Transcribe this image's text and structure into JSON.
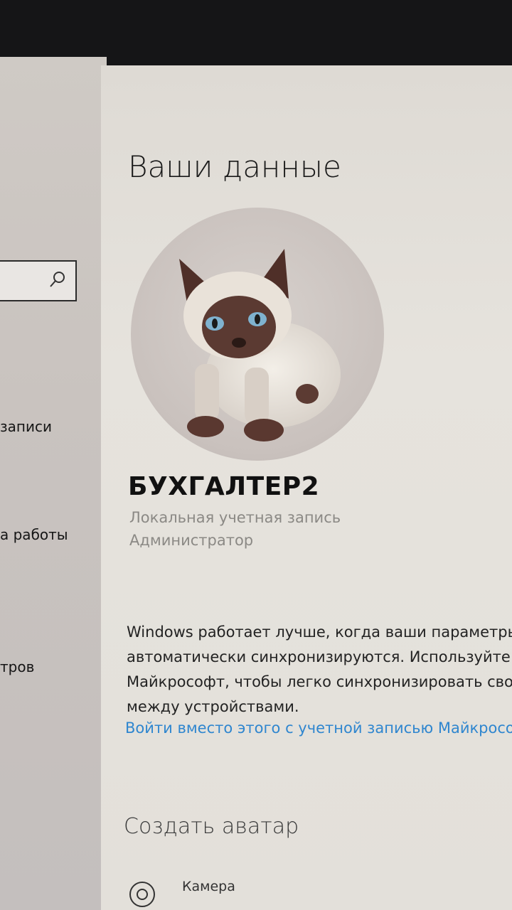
{
  "sidebar": {
    "search": {
      "placeholder": "",
      "icon": "search-icon"
    },
    "items": [
      {
        "label": "записи"
      },
      {
        "label": "а работы"
      },
      {
        "label": "тров"
      }
    ]
  },
  "main": {
    "title": "Ваши данные",
    "user": {
      "name": "БУХГАЛТЕР2",
      "account_type": "Локальная учетная запись",
      "role": "Администратор"
    },
    "sync_info": [
      "Windows работает лучше, когда ваши параметры",
      "автоматически синхронизируются. Используйте",
      "Майкрософт, чтобы легко синхронизировать сво",
      "между устройствами."
    ],
    "link": "Войти вместо этого с учетной записью Майкросо",
    "create_avatar": {
      "title": "Создать аватар",
      "options": [
        {
          "label": "Камера",
          "icon": "camera-icon"
        }
      ]
    }
  },
  "colors": {
    "accent": "#2f86cf",
    "sidebar_bg": "#c9c3bf",
    "main_bg": "#e3e0da",
    "secondary_text": "#8b8985"
  }
}
